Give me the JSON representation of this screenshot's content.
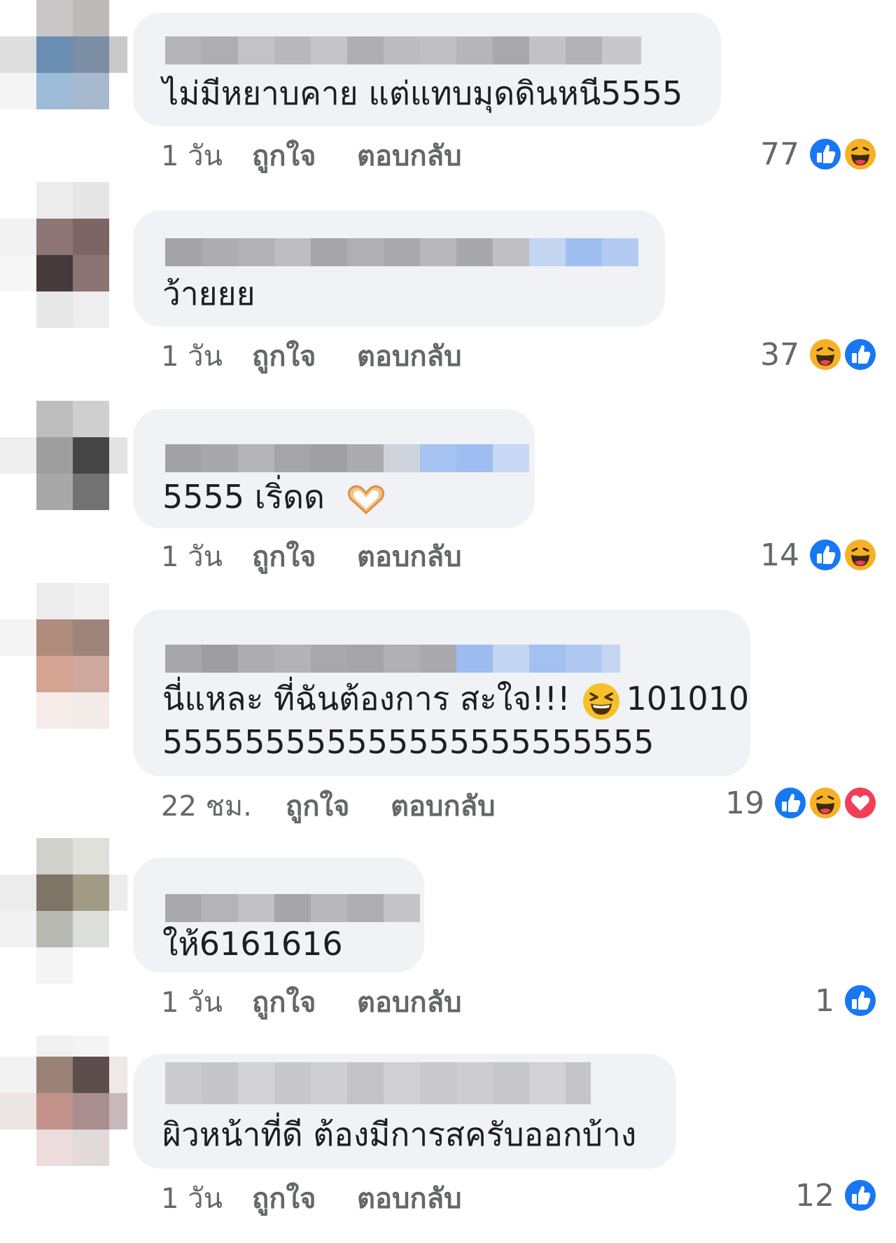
{
  "comments": [
    {
      "text": "ไม่มีหยาบคาย แต่แทบมุดดินหนี5555",
      "time": "1 วัน",
      "like_label": "ถูกใจ",
      "reply_label": "ตอบกลับ",
      "reaction_count": "77",
      "reactions": [
        "like-icon",
        "haha-icon"
      ]
    },
    {
      "text": "ว้ายยย",
      "time": "1 วัน",
      "like_label": "ถูกใจ",
      "reply_label": "ตอบกลับ",
      "reaction_count": "37",
      "reactions": [
        "haha-icon",
        "like-icon"
      ]
    },
    {
      "text": "5555 เริ่ดด",
      "emoji": "heart-hands-emoji",
      "time": "1 วัน",
      "like_label": "ถูกใจ",
      "reply_label": "ตอบกลับ",
      "reaction_count": "14",
      "reactions": [
        "like-icon",
        "haha-icon"
      ]
    },
    {
      "text_line1_a": "นี่แหละ ที่ฉันต้องการ สะใจ!!!",
      "text_line1_b": "101010",
      "text_line2": "555555555555555555555555",
      "emoji": "laughing-emoji",
      "time": "22 ชม.",
      "like_label": "ถูกใจ",
      "reply_label": "ตอบกลับ",
      "reaction_count": "19",
      "reactions": [
        "like-icon",
        "haha-icon",
        "love-icon"
      ]
    },
    {
      "text": "ให้6161616",
      "time": "1 วัน",
      "like_label": "ถูกใจ",
      "reply_label": "ตอบกลับ",
      "reaction_count": "1",
      "reactions": [
        "like-icon"
      ]
    },
    {
      "text": "ผิวหน้าที่ดี ต้องมีการสครับออกบ้าง",
      "time": "1 วัน",
      "like_label": "ถูกใจ",
      "reply_label": "ตอบกลับ",
      "reaction_count": "12",
      "reactions": [
        "like-icon"
      ]
    }
  ],
  "colors": {
    "like_blue": "#1877f2",
    "haha_yellow": "#f7b125",
    "love_red": "#f33e58",
    "bubble_bg": "#f0f2f5",
    "meta_gray": "#65676b"
  }
}
